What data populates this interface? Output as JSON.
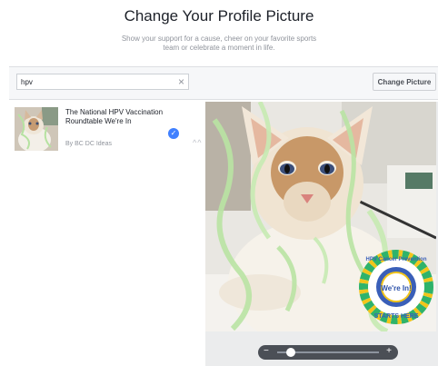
{
  "header": {
    "title": "Change Your Profile Picture",
    "subtitle": "Show your support for a cause, cheer on your favorite sports team or celebrate a moment in life."
  },
  "toolbar": {
    "search_value": "hpv",
    "change_button_label": "Change Picture"
  },
  "results": {
    "items": [
      {
        "title": "The National HPV Vaccination Roundtable We're In",
        "author": "By BC DC Ideas",
        "selected": true
      }
    ]
  },
  "preview": {
    "frame_badge": {
      "top_text": "HPV Cancer Prevention",
      "center_text": "We're In!",
      "bottom_text": "STARTS HERE"
    },
    "zoom_level": 0.1
  },
  "icons": {
    "clear": "close-icon",
    "check": "check-icon",
    "zoom_out": "minus-icon",
    "zoom_in": "plus-icon",
    "scroll": "chevron-up-icon"
  },
  "colors": {
    "accent": "#4080ff",
    "badge_green": "#2fb36b",
    "badge_yellow": "#f2c51b",
    "badge_blue": "#3a5fb8"
  }
}
